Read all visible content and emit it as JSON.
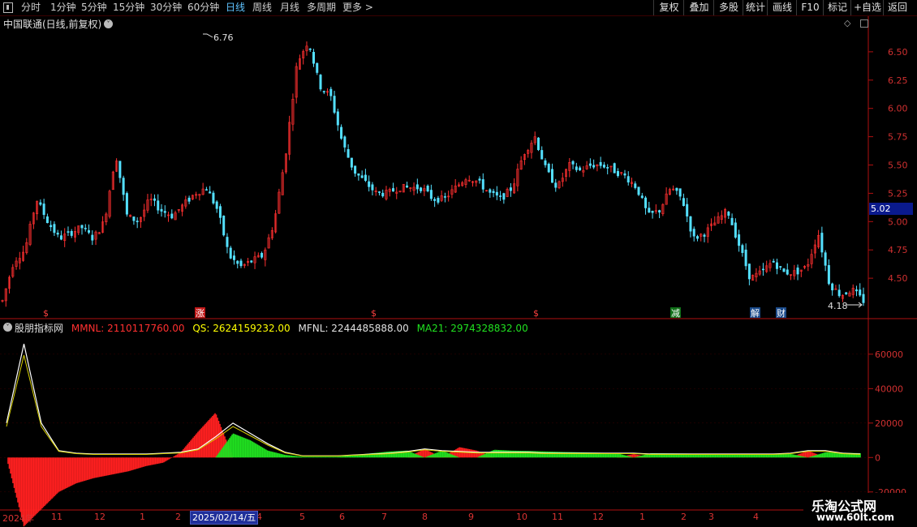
{
  "toolbar": {
    "periods": [
      "分时",
      "1分钟",
      "5分钟",
      "15分钟",
      "30分钟",
      "60分钟",
      "日线",
      "周线",
      "月线",
      "多周期",
      "更多 >"
    ],
    "active_index": 6,
    "right_buttons": [
      "复权",
      "叠加",
      "多股",
      "统计",
      "画线",
      "F10",
      "标记",
      "+自选",
      "返回"
    ]
  },
  "chart_header": {
    "title": "中国联通(日线,前复权)",
    "dropdown_icon": "chevron-down-icon"
  },
  "price_axis": {
    "ticks": [
      "6.50",
      "6.25",
      "6.00",
      "5.75",
      "5.50",
      "5.25",
      "5.00",
      "4.75",
      "4.50"
    ],
    "current_price": "5.02",
    "high_label": "6.76",
    "low_label": "4.18"
  },
  "event_markers": [
    "$",
    "涨",
    "$",
    "$",
    "减",
    "解",
    "财"
  ],
  "indicator": {
    "name": "股朋指标网",
    "mmnl": "MMNL: 2110117760.00",
    "qs": "QS: 2624159232.00",
    "mfnl": "MFNL: 2244485888.00",
    "ma21": "MA21: 2974328832.00",
    "ticks": [
      "60000",
      "40000",
      "20000",
      "0",
      "-20000"
    ],
    "colors": {
      "mmnl": "#ff3030",
      "qs": "#ffff00",
      "mfnl": "#e0e0e0",
      "ma21": "#20e020"
    }
  },
  "date_axis": {
    "labels": [
      "2024年",
      "11",
      "12",
      "1",
      "2",
      "3",
      "4",
      "5",
      "6",
      "7",
      "8",
      "9",
      "10",
      "11",
      "12",
      "1",
      "2",
      "3",
      "4"
    ],
    "cursor_label": "2025/02/14/五"
  },
  "watermark": {
    "line1": "乐淘公式网",
    "line2": "www.60lt.com"
  },
  "chart_data": [
    {
      "type": "candlestick",
      "title": "中国联通(日线,前复权)",
      "y_ticks": [
        4.5,
        4.75,
        5.0,
        5.25,
        5.5,
        5.75,
        6.0,
        6.25,
        6.5
      ],
      "ylim": [
        4.15,
        6.8
      ],
      "annotations": [
        {
          "label": "6.76",
          "value": 6.76
        },
        {
          "label": "4.18",
          "value": 4.18
        }
      ],
      "close_path": [
        4.3,
        4.65,
        4.75,
        5.2,
        5.0,
        4.85,
        4.9,
        4.95,
        4.85,
        5.0,
        5.6,
        5.05,
        5.0,
        5.2,
        5.1,
        5.05,
        5.15,
        5.25,
        5.3,
        5.1,
        4.7,
        4.6,
        4.65,
        4.7,
        5.0,
        5.6,
        6.4,
        6.6,
        6.2,
        6.1,
        5.7,
        5.45,
        5.35,
        5.25,
        5.25,
        5.3,
        5.3,
        5.3,
        5.2,
        5.2,
        5.3,
        5.4,
        5.35,
        5.25,
        5.2,
        5.3,
        5.6,
        5.75,
        5.45,
        5.3,
        5.5,
        5.45,
        5.5,
        5.5,
        5.45,
        5.4,
        5.3,
        5.05,
        5.1,
        5.3,
        5.2,
        4.85,
        4.9,
        5.0,
        5.1,
        4.8,
        4.5,
        4.55,
        4.65,
        4.55,
        4.55,
        4.6,
        4.9,
        4.45,
        4.35,
        4.4,
        4.3
      ]
    },
    {
      "type": "area",
      "title": "股朋指标网",
      "ylim": [
        -30000,
        75000
      ],
      "y_ticks": [
        60000,
        40000,
        20000,
        0,
        -20000
      ],
      "series": [
        {
          "name": "MMNL",
          "color": "#ff3030"
        },
        {
          "name": "QS",
          "color": "#ffff00"
        },
        {
          "name": "MFNL",
          "color": "#e0e0e0"
        },
        {
          "name": "MA21",
          "color": "#20e020"
        }
      ],
      "line_path": [
        20000,
        66000,
        20000,
        4000,
        2500,
        2000,
        2000,
        2000,
        2000,
        2500,
        3000,
        5000,
        12000,
        20000,
        14000,
        8000,
        3000,
        1000,
        1000,
        1000,
        1500,
        2000,
        2500,
        3500,
        5000,
        4000,
        3500,
        3000,
        3000,
        3000,
        3000,
        2500,
        2500,
        2500,
        2500,
        2500,
        2500,
        2000,
        2000,
        2000,
        2000,
        2000,
        2000,
        2000,
        2000,
        2500,
        4000,
        4000,
        2500,
        2000
      ],
      "red_area_path": [
        0,
        -40000,
        -30000,
        -20000,
        -15000,
        -12000,
        -10000,
        -8000,
        -5000,
        -3000,
        3000,
        15000,
        26000,
        0,
        0,
        0,
        0,
        0,
        0,
        0,
        0,
        0,
        0,
        0,
        5000,
        0,
        6000,
        4000,
        0,
        0,
        0,
        0,
        0,
        0,
        0,
        0,
        2000,
        0,
        0,
        0,
        0,
        0,
        0,
        0,
        0,
        0,
        4000,
        0,
        0,
        0
      ],
      "green_area_path": [
        0,
        0,
        0,
        0,
        0,
        0,
        0,
        0,
        0,
        0,
        0,
        0,
        0,
        14000,
        10000,
        4000,
        1500,
        500,
        500,
        500,
        1500,
        2500,
        3500,
        4000,
        0,
        4000,
        0,
        0,
        4500,
        4000,
        3800,
        3500,
        3200,
        3000,
        2800,
        2600,
        0,
        2500,
        2400,
        2300,
        2200,
        2100,
        2000,
        2000,
        2000,
        2100,
        0,
        3000,
        2800,
        2500
      ]
    }
  ]
}
